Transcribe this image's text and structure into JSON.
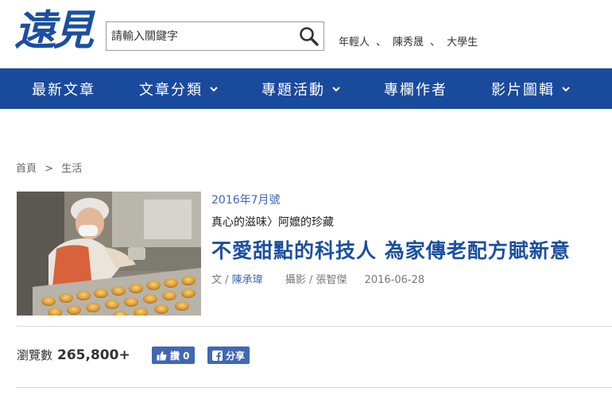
{
  "header": {
    "logo": "遠見",
    "search": {
      "placeholder": "請輸入關鍵字",
      "value": ""
    },
    "hot_tags": [
      "年輕人",
      "陳秀晟",
      "大學生"
    ],
    "hot_tag_separator": "、"
  },
  "nav": {
    "items": [
      {
        "label": "最新文章",
        "dropdown": false
      },
      {
        "label": "文章分類",
        "dropdown": true
      },
      {
        "label": "專題活動",
        "dropdown": true
      },
      {
        "label": "專欄作者",
        "dropdown": false
      },
      {
        "label": "影片圖輯",
        "dropdown": true
      }
    ]
  },
  "breadcrumb": {
    "home": "首頁",
    "separator": ">",
    "current": "生活"
  },
  "article": {
    "issue": "2016年7月號",
    "column": "真心的滋味〉阿嬤的珍藏",
    "title": "不愛甜點的科技人 為家傳老配方賦新意",
    "author_prefix": "文 / ",
    "author": "陳承瑋",
    "photographer": "攝影 / 張智傑",
    "date": "2016-06-28"
  },
  "stats": {
    "views_label": "瀏覽數",
    "views_count": "265,800+",
    "like_label": "讚 0",
    "share_label": "分享"
  },
  "colors": {
    "brand_blue": "#1a4a9c",
    "link_blue": "#3a68b8",
    "title_blue": "#1b4fa0",
    "fb_blue": "#4267b2"
  }
}
